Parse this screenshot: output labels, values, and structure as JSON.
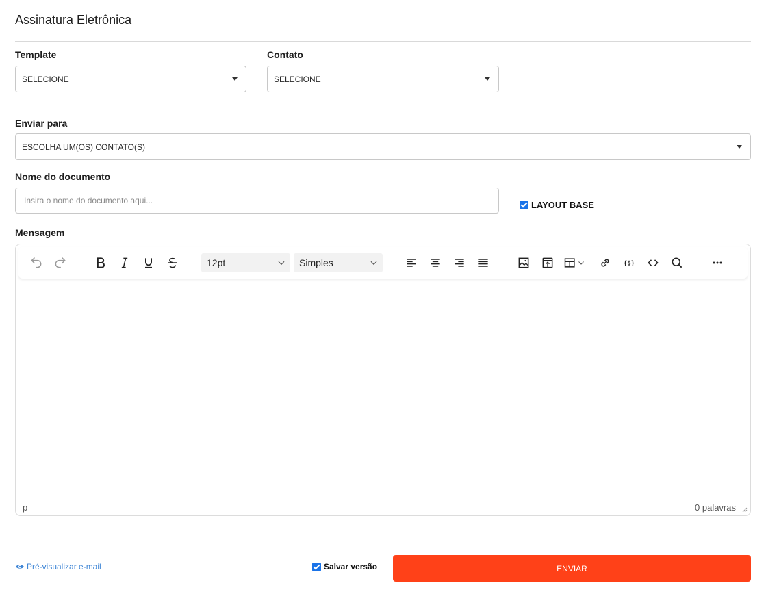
{
  "page": {
    "title": "Assinatura Eletrônica"
  },
  "template": {
    "label": "Template",
    "value": "SELECIONE"
  },
  "contato": {
    "label": "Contato",
    "value": "SELECIONE"
  },
  "enviar_para": {
    "label": "Enviar para",
    "value": "ESCOLHA UM(OS) CONTATO(S)"
  },
  "nome_documento": {
    "label": "Nome do documento",
    "placeholder": "Insira o nome do documento aqui..."
  },
  "layout_base": {
    "label": "LAYOUT BASE",
    "checked": true
  },
  "mensagem": {
    "label": "Mensagem"
  },
  "editor": {
    "font_size": "12pt",
    "block_format": "Simples",
    "status_path": "p",
    "word_count": "0 palavras"
  },
  "footer": {
    "preview_label": "Pré-visualizar e-mail",
    "save_version_label": "Salvar versão",
    "save_version_checked": true,
    "send_label": "ENVIAR"
  },
  "colors": {
    "accent": "#ff4118",
    "link": "#3f86d6",
    "checkbox": "#1a73e8"
  }
}
